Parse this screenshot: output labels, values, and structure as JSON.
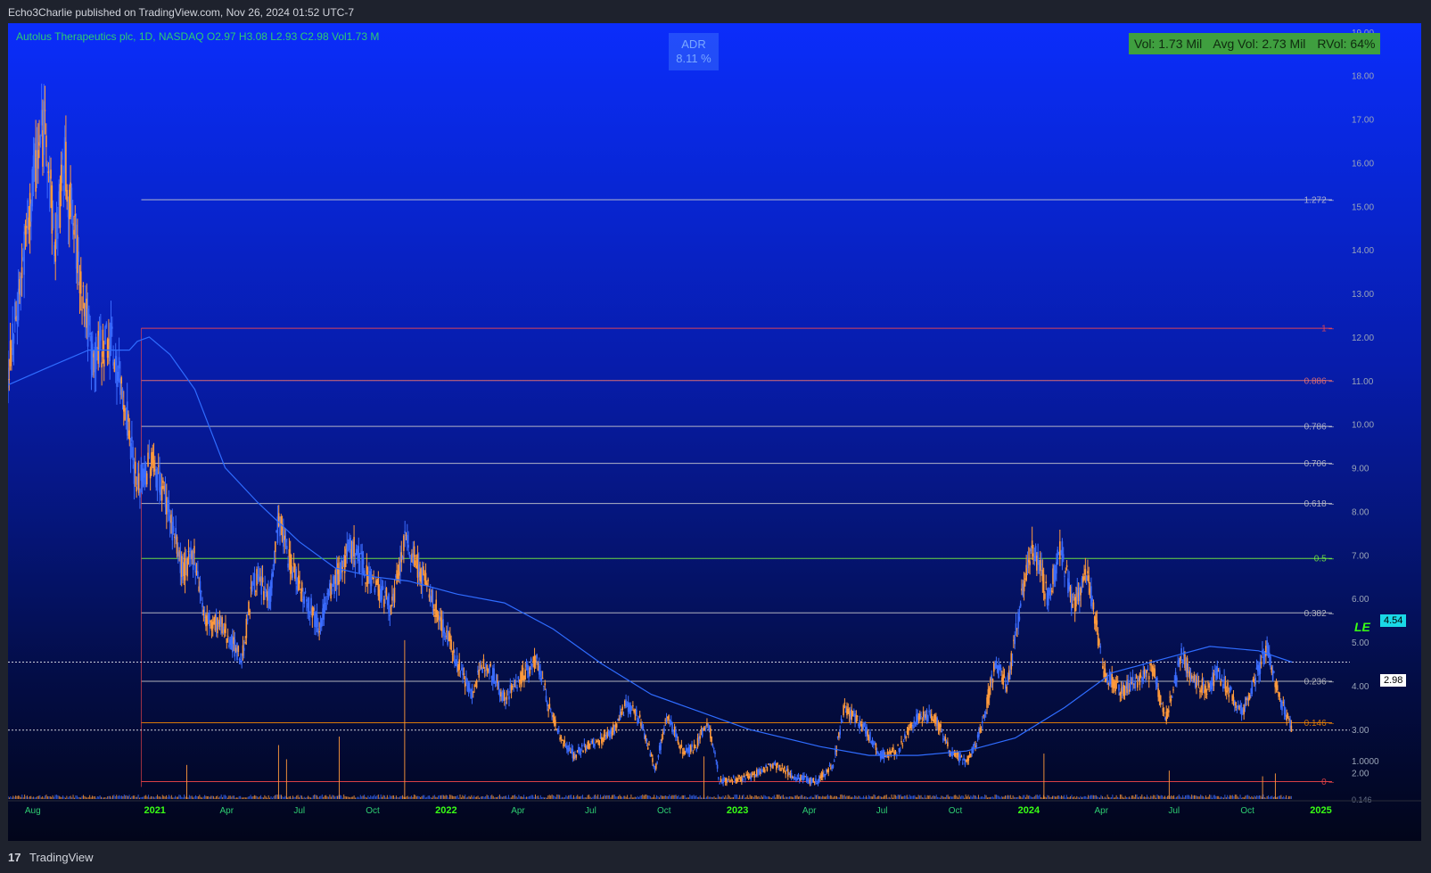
{
  "header": {
    "publisher_text": "Echo3Charlie published on TradingView.com, Nov 26, 2024 01:52 UTC-7"
  },
  "footer": {
    "logo_glyph": "17",
    "brand": "TradingView"
  },
  "colors": {
    "legend_text": "#2ecc71",
    "bull_candle": "#3b6cff",
    "bear_candle": "#ff9a3c",
    "moving_average": "#2f6cff",
    "fib_top_bottom": "#ff4a4a",
    "fib_0886": "#ff7a6a",
    "fib_0146": "#ff8c00",
    "fib_05": "#7dff3c",
    "fib_other": "#d0d0d0",
    "price_line": "#ffffff",
    "ma_tag": "#1ad8e6",
    "vol_box": "#3f9f3f",
    "le_label": "#39ff14"
  },
  "legend": {
    "text": "Autolus Therapeutics plc, 1D, NASDAQ  O2.97  H3.08  L2.93  C2.98  Vol1.73 M"
  },
  "adr": {
    "label": "ADR",
    "value": "8.11 %"
  },
  "volume_box": {
    "vol": "Vol: 1.73 Mil",
    "avg_vol": "Avg Vol: 2.73 Mil",
    "rvol": "RVol: 64%"
  },
  "tags": {
    "ma_value": "4.54",
    "last_price": "2.98",
    "le_label": "LE"
  },
  "chart_data": {
    "type": "candlestick",
    "symbol": "Autolus Therapeutics plc",
    "exchange": "NASDAQ",
    "interval": "1D",
    "last_bar": {
      "open": 2.97,
      "high": 3.08,
      "low": 2.93,
      "close": 2.98,
      "volume": "1.73 M"
    },
    "price_axis": {
      "ticks": [
        "19.00",
        "18.00",
        "17.00",
        "16.00",
        "15.00",
        "14.00",
        "13.00",
        "12.00",
        "11.00",
        "10.00",
        "9.00",
        "8.00",
        "7.00",
        "6.00",
        "5.00",
        "4.00",
        "3.00",
        "2.00"
      ],
      "range": [
        1.4,
        19.2
      ]
    },
    "volume_axis": {
      "ticks": [
        "1.0000",
        "0.146"
      ]
    },
    "time_axis": {
      "ticks": [
        {
          "label": "Aug",
          "year": false
        },
        {
          "label": "2021",
          "year": true
        },
        {
          "label": "Apr",
          "year": false
        },
        {
          "label": "Jul",
          "year": false
        },
        {
          "label": "Oct",
          "year": false
        },
        {
          "label": "2022",
          "year": true
        },
        {
          "label": "Apr",
          "year": false
        },
        {
          "label": "Jul",
          "year": false
        },
        {
          "label": "Oct",
          "year": false
        },
        {
          "label": "2023",
          "year": true
        },
        {
          "label": "Apr",
          "year": false
        },
        {
          "label": "Jul",
          "year": false
        },
        {
          "label": "Oct",
          "year": false
        },
        {
          "label": "2024",
          "year": true
        },
        {
          "label": "Apr",
          "year": false
        },
        {
          "label": "Jul",
          "year": false
        },
        {
          "label": "Oct",
          "year": false
        },
        {
          "label": "2025",
          "year": true
        }
      ],
      "range": [
        "2020-07-01",
        "2025-01-15"
      ]
    },
    "price_path": [
      [
        "2020-07-01",
        11.0
      ],
      [
        "2020-07-15",
        13.0
      ],
      [
        "2020-08-05",
        16.0
      ],
      [
        "2020-08-18",
        17.0
      ],
      [
        "2020-08-28",
        14.0
      ],
      [
        "2020-09-10",
        16.0
      ],
      [
        "2020-09-25",
        14.0
      ],
      [
        "2020-10-15",
        11.5
      ],
      [
        "2020-11-05",
        12.0
      ],
      [
        "2020-11-25",
        10.5
      ],
      [
        "2020-12-10",
        8.5
      ],
      [
        "2020-12-28",
        9.2
      ],
      [
        "2021-01-15",
        8.3
      ],
      [
        "2021-02-05",
        6.6
      ],
      [
        "2021-02-20",
        7.0
      ],
      [
        "2021-03-05",
        5.5
      ],
      [
        "2021-03-25",
        5.4
      ],
      [
        "2021-04-20",
        4.6
      ],
      [
        "2021-05-05",
        6.5
      ],
      [
        "2021-05-25",
        6.0
      ],
      [
        "2021-06-05",
        7.8
      ],
      [
        "2021-06-20",
        6.8
      ],
      [
        "2021-07-10",
        6.0
      ],
      [
        "2021-07-25",
        5.4
      ],
      [
        "2021-08-15",
        6.4
      ],
      [
        "2021-09-05",
        7.2
      ],
      [
        "2021-09-20",
        6.7
      ],
      [
        "2021-10-10",
        6.2
      ],
      [
        "2021-10-25",
        5.8
      ],
      [
        "2021-11-10",
        7.3
      ],
      [
        "2021-12-01",
        6.6
      ],
      [
        "2021-12-20",
        5.7
      ],
      [
        "2022-01-10",
        4.8
      ],
      [
        "2022-02-01",
        3.8
      ],
      [
        "2022-02-20",
        4.6
      ],
      [
        "2022-03-15",
        3.7
      ],
      [
        "2022-04-05",
        4.2
      ],
      [
        "2022-04-25",
        4.6
      ],
      [
        "2022-05-10",
        3.5
      ],
      [
        "2022-05-25",
        2.8
      ],
      [
        "2022-06-10",
        2.4
      ],
      [
        "2022-06-25",
        2.6
      ],
      [
        "2022-07-10",
        2.7
      ],
      [
        "2022-07-30",
        3.0
      ],
      [
        "2022-08-15",
        3.6
      ],
      [
        "2022-09-01",
        3.2
      ],
      [
        "2022-09-20",
        2.1
      ],
      [
        "2022-10-05",
        3.3
      ],
      [
        "2022-10-25",
        2.5
      ],
      [
        "2022-11-10",
        2.6
      ],
      [
        "2022-11-25",
        3.2
      ],
      [
        "2022-12-10",
        1.8
      ],
      [
        "2023-01-15",
        1.9
      ],
      [
        "2023-02-15",
        2.2
      ],
      [
        "2023-03-15",
        1.9
      ],
      [
        "2023-04-10",
        1.8
      ],
      [
        "2023-05-01",
        2.2
      ],
      [
        "2023-05-15",
        3.5
      ],
      [
        "2023-06-10",
        3.0
      ],
      [
        "2023-06-30",
        2.4
      ],
      [
        "2023-07-20",
        2.5
      ],
      [
        "2023-08-15",
        3.3
      ],
      [
        "2023-09-05",
        3.3
      ],
      [
        "2023-09-25",
        2.5
      ],
      [
        "2023-10-15",
        2.2
      ],
      [
        "2023-11-01",
        2.9
      ],
      [
        "2023-11-20",
        4.5
      ],
      [
        "2023-12-05",
        4.0
      ],
      [
        "2023-12-25",
        6.2
      ],
      [
        "2024-01-05",
        7.3
      ],
      [
        "2024-01-25",
        6.0
      ],
      [
        "2024-02-10",
        7.2
      ],
      [
        "2024-02-25",
        5.8
      ],
      [
        "2024-03-15",
        6.5
      ],
      [
        "2024-04-05",
        4.3
      ],
      [
        "2024-04-25",
        3.9
      ],
      [
        "2024-05-15",
        4.1
      ],
      [
        "2024-06-05",
        4.4
      ],
      [
        "2024-06-20",
        3.2
      ],
      [
        "2024-07-10",
        4.7
      ],
      [
        "2024-07-25",
        4.2
      ],
      [
        "2024-08-10",
        3.9
      ],
      [
        "2024-08-25",
        4.3
      ],
      [
        "2024-09-10",
        3.8
      ],
      [
        "2024-09-25",
        3.4
      ],
      [
        "2024-10-10",
        4.1
      ],
      [
        "2024-10-25",
        4.9
      ],
      [
        "2024-11-10",
        3.7
      ],
      [
        "2024-11-26",
        2.98
      ]
    ],
    "moving_average": [
      [
        "2020-07-01",
        10.9
      ],
      [
        "2020-08-20",
        11.3
      ],
      [
        "2020-10-10",
        11.7
      ],
      [
        "2020-11-30",
        11.7
      ],
      [
        "2020-12-10",
        11.9
      ],
      [
        "2020-12-25",
        12.0
      ],
      [
        "2021-01-20",
        11.6
      ],
      [
        "2021-02-20",
        10.8
      ],
      [
        "2021-03-30",
        9.0
      ],
      [
        "2021-05-10",
        8.2
      ],
      [
        "2021-07-01",
        7.3
      ],
      [
        "2021-08-15",
        6.7
      ],
      [
        "2021-10-01",
        6.5
      ],
      [
        "2021-11-15",
        6.4
      ],
      [
        "2022-01-15",
        6.1
      ],
      [
        "2022-03-15",
        5.9
      ],
      [
        "2022-05-15",
        5.3
      ],
      [
        "2022-07-15",
        4.5
      ],
      [
        "2022-09-15",
        3.8
      ],
      [
        "2022-11-15",
        3.4
      ],
      [
        "2023-01-15",
        3.0
      ],
      [
        "2023-04-15",
        2.6
      ],
      [
        "2023-06-15",
        2.4
      ],
      [
        "2023-08-15",
        2.4
      ],
      [
        "2023-10-15",
        2.5
      ],
      [
        "2023-12-15",
        2.8
      ],
      [
        "2024-02-15",
        3.5
      ],
      [
        "2024-04-15",
        4.3
      ],
      [
        "2024-06-15",
        4.6
      ],
      [
        "2024-08-15",
        4.9
      ],
      [
        "2024-10-15",
        4.8
      ],
      [
        "2024-11-26",
        4.54
      ]
    ],
    "fib_levels": [
      {
        "label": "1",
        "price": 12.2,
        "color": "#ff4a4a"
      },
      {
        "label": "1.272",
        "price": 15.15,
        "color": "#d0d0d0"
      },
      {
        "label": "0.886",
        "price": 11.0,
        "color": "#ff7a6a"
      },
      {
        "label": "0.786",
        "price": 9.95,
        "color": "#d0d0d0"
      },
      {
        "label": "0.706",
        "price": 9.1,
        "color": "#d0d0d0"
      },
      {
        "label": "0.618",
        "price": 8.18,
        "color": "#d0d0d0"
      },
      {
        "label": "0.5",
        "price": 6.92,
        "color": "#7dff3c"
      },
      {
        "label": "0.382",
        "price": 5.67,
        "color": "#d0d0d0"
      },
      {
        "label": "0.236",
        "price": 4.1,
        "color": "#d0d0d0"
      },
      {
        "label": "0.146",
        "price": 3.15,
        "color": "#ff8c00"
      },
      {
        "label": "0",
        "price": 1.8,
        "color": "#ff4a4a"
      }
    ],
    "fib_start": "2020-12-15",
    "volume_spikes": [
      [
        "2021-02-10",
        0.6
      ],
      [
        "2021-06-05",
        0.95
      ],
      [
        "2021-06-15",
        0.7
      ],
      [
        "2021-08-20",
        1.1
      ],
      [
        "2021-11-10",
        2.8
      ],
      [
        "2022-11-20",
        0.75
      ],
      [
        "2024-01-20",
        0.8
      ],
      [
        "2024-06-25",
        0.5
      ],
      [
        "2024-10-20",
        0.4
      ],
      [
        "2024-11-05",
        0.45
      ]
    ],
    "volume_ylim": [
      0,
      1.1
    ],
    "horizontal_lines": [
      {
        "name": "ma-value-line",
        "price": 4.54
      },
      {
        "name": "last-price-line",
        "price": 2.98
      }
    ]
  }
}
